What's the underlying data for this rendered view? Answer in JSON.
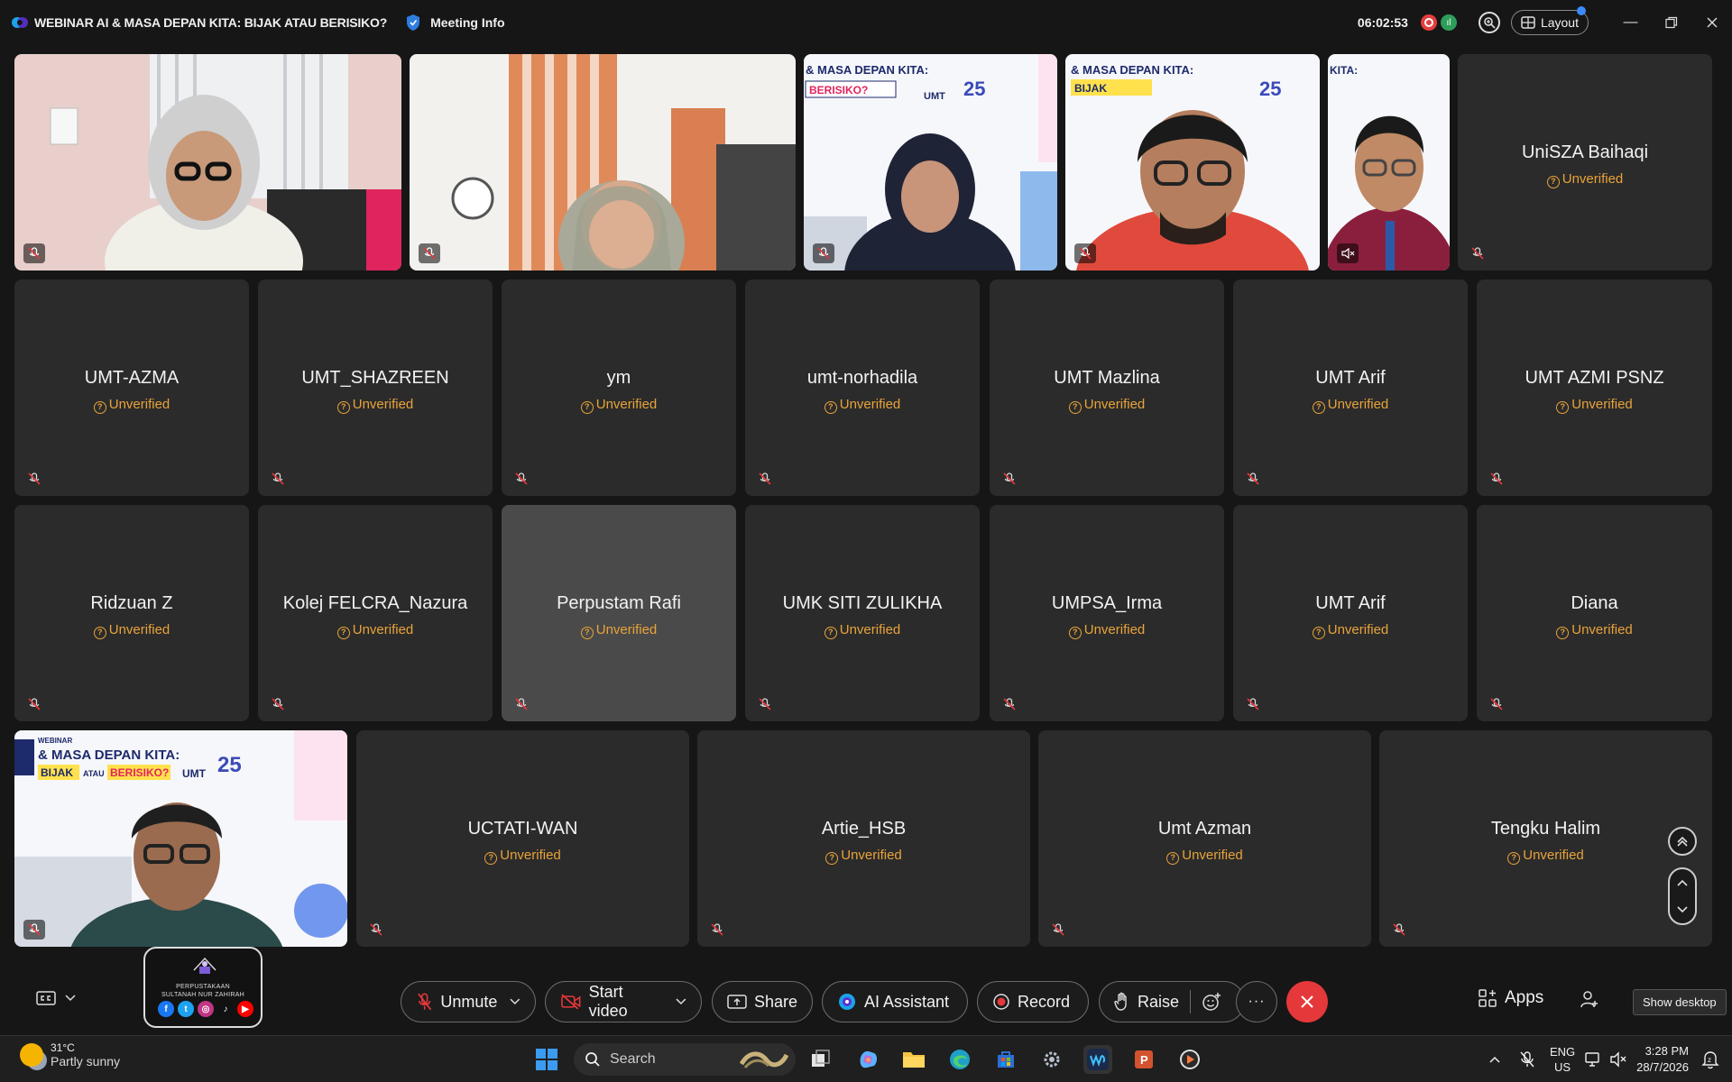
{
  "titlebar": {
    "title": "WEBINAR AI & MASA DEPAN KITA: BIJAK ATAU BERISIKO?",
    "meeting_info": "Meeting Info",
    "timer": "06:02:53",
    "layout_label": "Layout"
  },
  "slide": {
    "kicker": "WEBINAR",
    "line1": "& MASA DEPAN KITA:",
    "bijak": "BIJAK",
    "atau": "ATAU",
    "berisiko": "BERISIKO?",
    "umt": "UMT",
    "anniv": "25",
    "kita": "KITA:"
  },
  "video_tiles": [
    {
      "id": "video-tile-1"
    },
    {
      "id": "video-tile-2"
    },
    {
      "id": "video-tile-3"
    },
    {
      "id": "video-tile-4"
    },
    {
      "id": "video-tile-5"
    }
  ],
  "participants_row1": [
    {
      "name": "UniSZA Baihaqi",
      "status": "Unverified"
    }
  ],
  "participants_row2": [
    {
      "name": "UMT-AZMA",
      "status": "Unverified"
    },
    {
      "name": "UMT_SHAZREEN",
      "status": "Unverified"
    },
    {
      "name": "ym",
      "status": "Unverified"
    },
    {
      "name": "umt-norhadila",
      "status": "Unverified"
    },
    {
      "name": "UMT Mazlina",
      "status": "Unverified"
    },
    {
      "name": "UMT Arif",
      "status": "Unverified"
    },
    {
      "name": "UMT AZMI PSNZ",
      "status": "Unverified"
    }
  ],
  "participants_row3": [
    {
      "name": "Ridzuan Z",
      "status": "Unverified"
    },
    {
      "name": "Kolej FELCRA_Nazura",
      "status": "Unverified"
    },
    {
      "name": "Perpustam Rafi",
      "status": "Unverified"
    },
    {
      "name": "UMK SITI ZULIKHA",
      "status": "Unverified"
    },
    {
      "name": "UMPSA_Irma",
      "status": "Unverified"
    },
    {
      "name": "UMT Arif",
      "status": "Unverified"
    },
    {
      "name": "Diana",
      "status": "Unverified"
    }
  ],
  "participants_row4": [
    {
      "name": "UCTATI-WAN",
      "status": "Unverified"
    },
    {
      "name": "Artie_HSB",
      "status": "Unverified"
    },
    {
      "name": "Umt Azman",
      "status": "Unverified"
    },
    {
      "name": "Tengku Halim",
      "status": "Unverified"
    }
  ],
  "library_card": {
    "line1": "PERPUSTAKAAN",
    "line2": "SULTANAH NUR ZAHIRAH"
  },
  "toolbar": {
    "unmute": "Unmute",
    "start_video": "Start video",
    "share": "Share",
    "ai_assistant": "AI Assistant",
    "record": "Record",
    "raise": "Raise",
    "more": "···",
    "apps": "Apps",
    "show_desktop": "Show desktop"
  },
  "taskbar": {
    "temperature": "31°C",
    "weather": "Partly sunny",
    "search_placeholder": "Search",
    "lang_line1": "ENG",
    "lang_line2": "US",
    "time": "3:28 PM",
    "date": "28/7/2026"
  },
  "colors": {
    "accent": "#3b8bff",
    "unverified": "#e8a33a",
    "end_call": "#e5383b",
    "tile": "#2b2b2b"
  }
}
